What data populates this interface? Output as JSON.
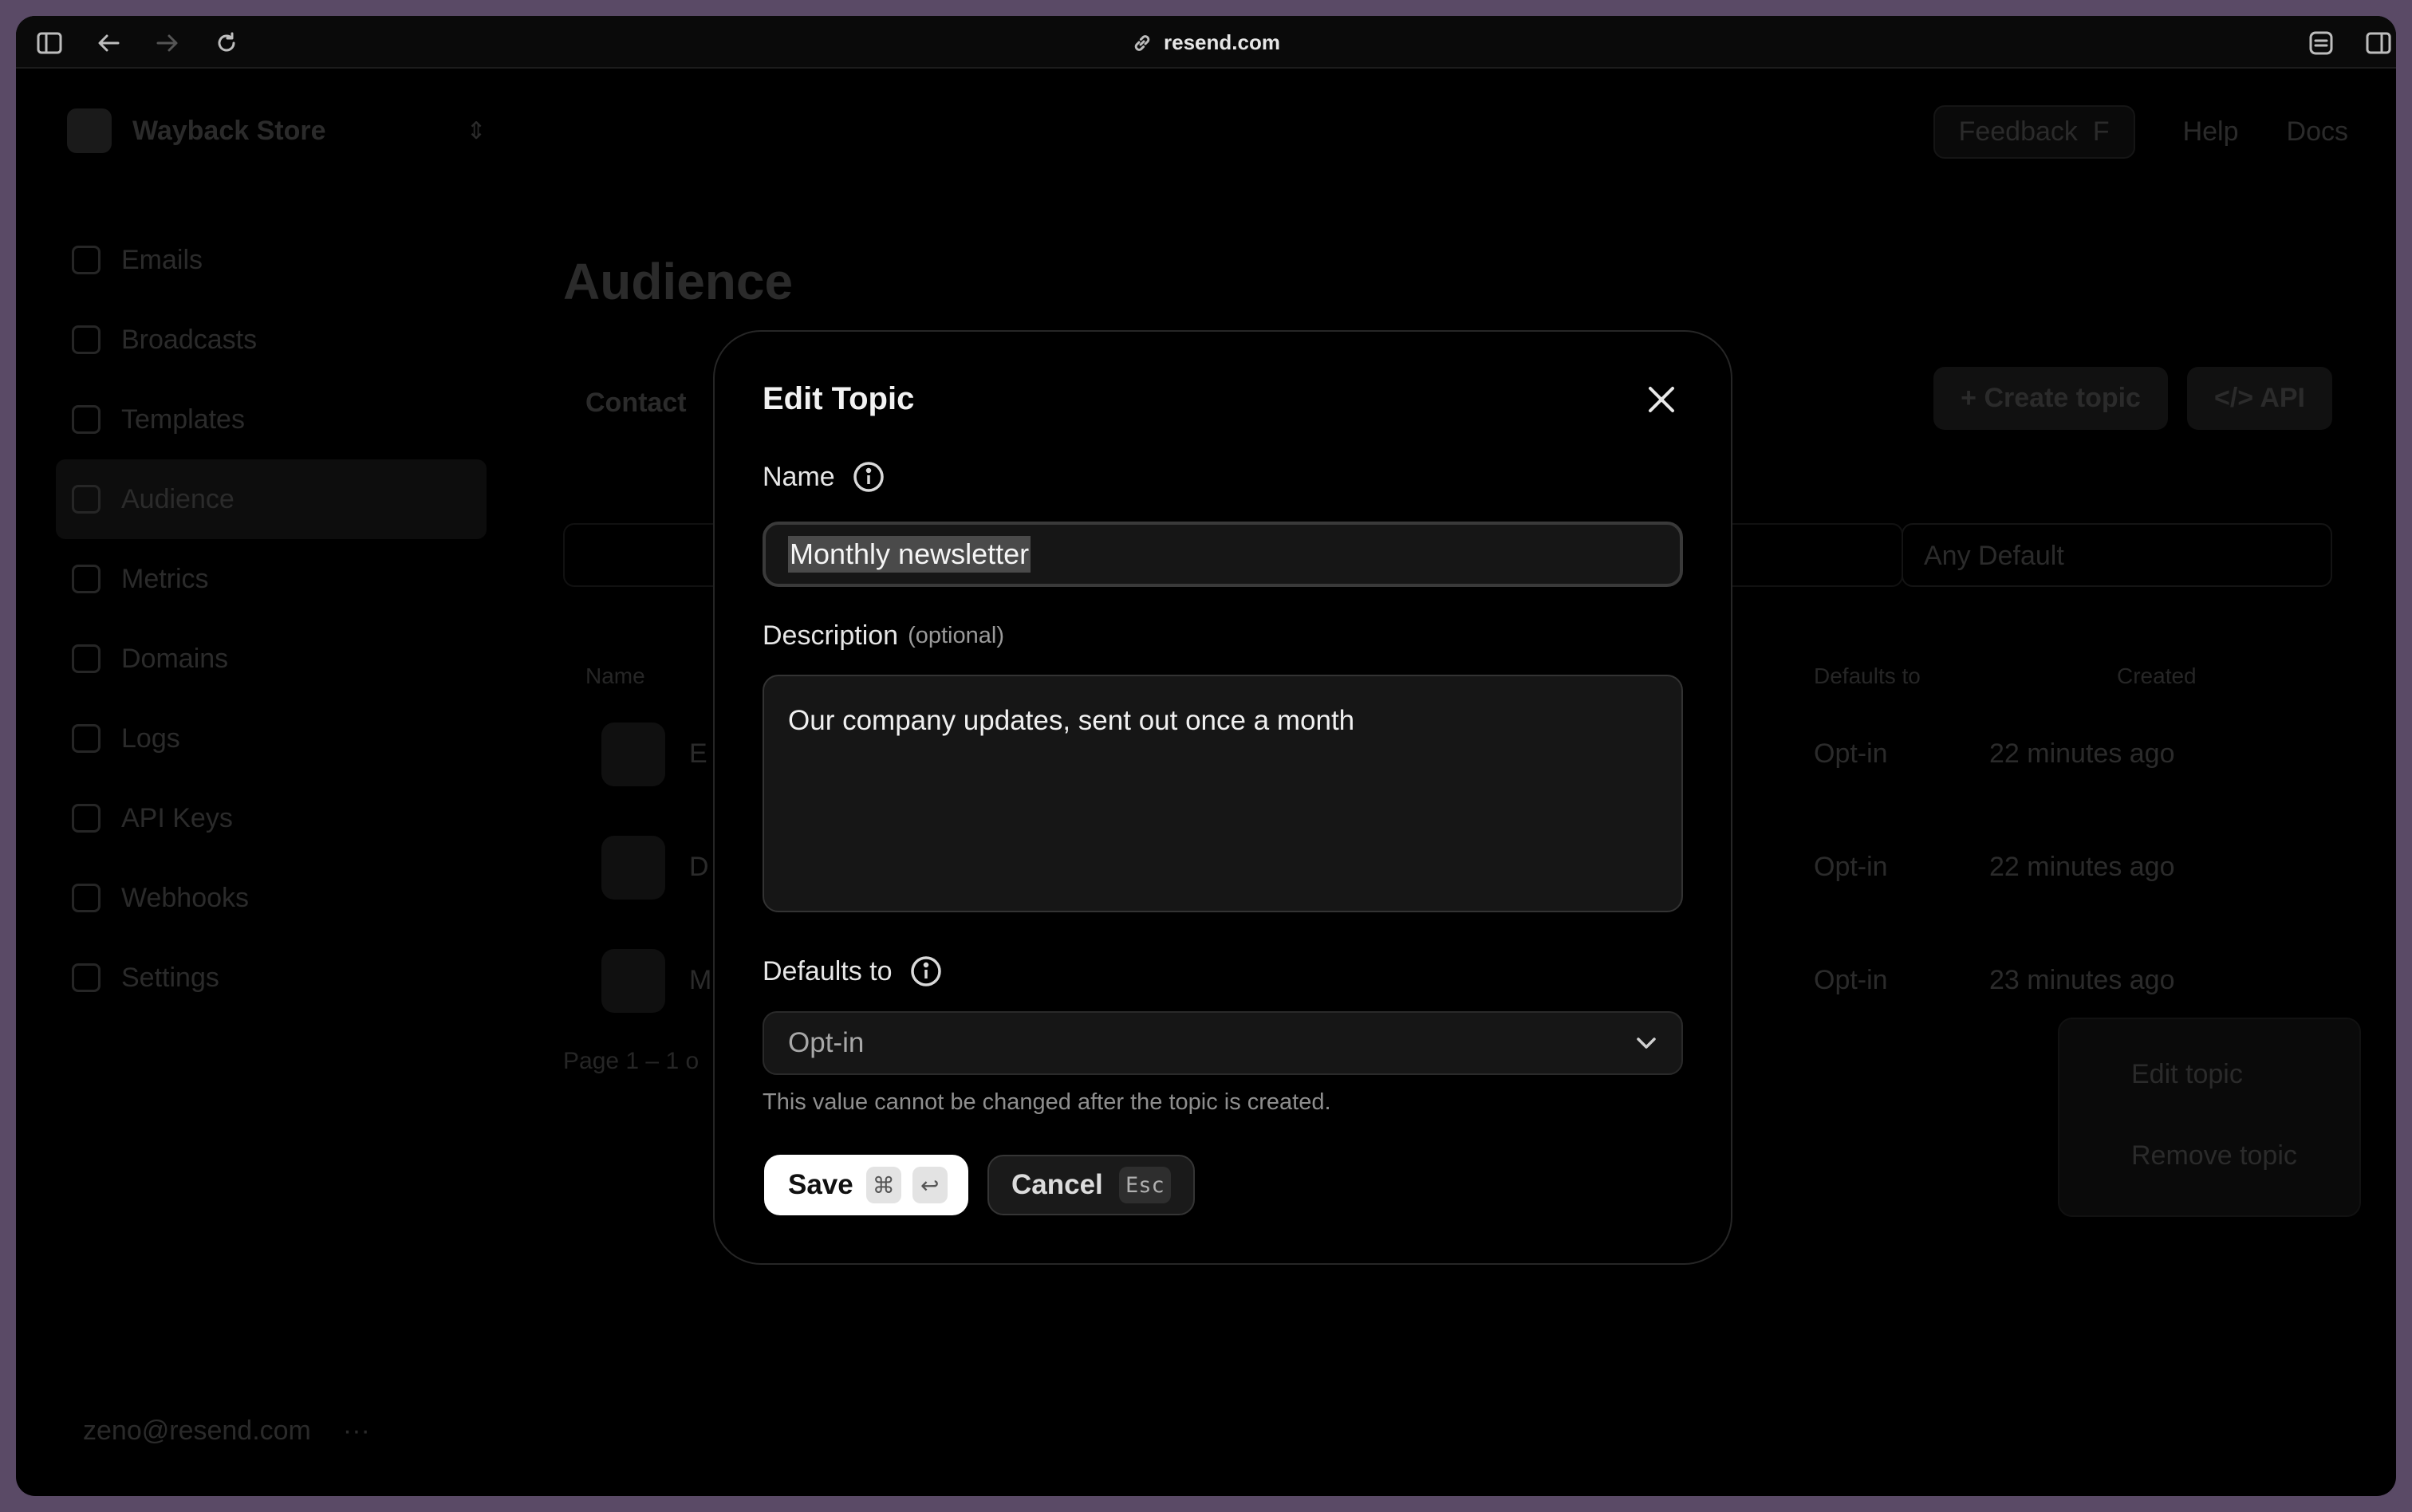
{
  "browser": {
    "url": "resend.com"
  },
  "app": {
    "team_name": "Wayback Store",
    "nav": [
      {
        "label": "Emails"
      },
      {
        "label": "Broadcasts"
      },
      {
        "label": "Templates"
      },
      {
        "label": "Audience"
      },
      {
        "label": "Metrics"
      },
      {
        "label": "Domains"
      },
      {
        "label": "Logs"
      },
      {
        "label": "API Keys"
      },
      {
        "label": "Webhooks"
      },
      {
        "label": "Settings"
      }
    ],
    "user_email": "zeno@resend.com",
    "topnav": {
      "feedback": "Feedback",
      "feedback_key": "F",
      "help": "Help",
      "docs": "Docs"
    },
    "page_title": "Audience",
    "tab": "Contact",
    "create_topic": "Create topic",
    "api": "API",
    "filter": "Any Default",
    "table_headers": {
      "name": "Name",
      "defaults_to": "Defaults to",
      "created": "Created"
    },
    "rows": [
      {
        "letter": "E",
        "default": "Opt-in",
        "created": "22 minutes ago"
      },
      {
        "letter": "D",
        "default": "Opt-in",
        "created": "22 minutes ago"
      },
      {
        "letter": "M",
        "default": "Opt-in",
        "created": "23 minutes ago"
      }
    ],
    "pager": "Page 1 – 1 o",
    "row_menu": {
      "edit": "Edit topic",
      "remove": "Remove topic"
    }
  },
  "modal": {
    "title": "Edit Topic",
    "name_label": "Name",
    "name_value": "Monthly newsletter",
    "description_label": "Description",
    "description_optional": "(optional)",
    "description_value": "Our company updates, sent out once a month",
    "defaults_label": "Defaults to",
    "defaults_value": "Opt-in",
    "defaults_hint": "This value cannot be changed after the topic is created.",
    "save_label": "Save",
    "save_key_1": "⌘",
    "save_key_2": "↩",
    "cancel_label": "Cancel",
    "cancel_key": "Esc"
  }
}
